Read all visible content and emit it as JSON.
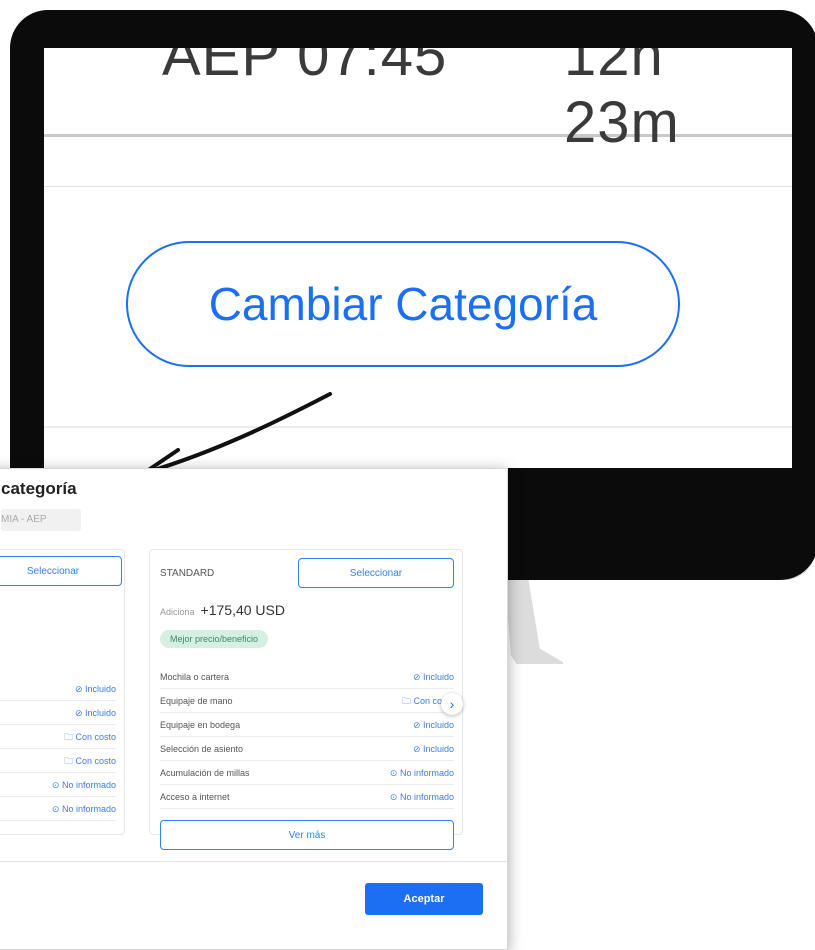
{
  "screen": {
    "departure_time": "AEP 07:45",
    "duration": "12h 23m",
    "change_category_label": "Cambiar Categoría"
  },
  "modal": {
    "title": "categoría",
    "route": "MIA - AEP",
    "accept_label": "Aceptar",
    "next_icon": "chevron-right-icon",
    "cards": [
      {
        "select_label": "Seleccionar",
        "features": [
          {
            "status": "⊘ Incluido"
          },
          {
            "status": "⊘ Incluido"
          },
          {
            "status": "🗀 Con costo"
          },
          {
            "status": "🗀 Con costo"
          },
          {
            "status": "⊙ No informado"
          },
          {
            "status": "⊙ No informado"
          }
        ]
      },
      {
        "name": "STANDARD",
        "select_label": "Seleccionar",
        "price_prefix": "Adiciona",
        "price": "+175,40 USD",
        "badge": "Mejor precio/beneficio",
        "features": [
          {
            "label": "Mochila o cartera",
            "status": "⊘ Incluido"
          },
          {
            "label": "Equipaje de mano",
            "status": "🗀 Con costo"
          },
          {
            "label": "Equipaje en bodega",
            "status": "⊘ Incluido"
          },
          {
            "label": "Selección de asiento",
            "status": "⊘ Incluido"
          },
          {
            "label": "Acumulación de millas",
            "status": "⊙ No informado"
          },
          {
            "label": "Acceso a internet",
            "status": "⊙ No informado"
          }
        ],
        "more_label": "Ver más"
      }
    ]
  },
  "colors": {
    "accent": "#1c6ff3",
    "badge_bg": "#d5efe3",
    "monitor": "#0b0b0b"
  }
}
